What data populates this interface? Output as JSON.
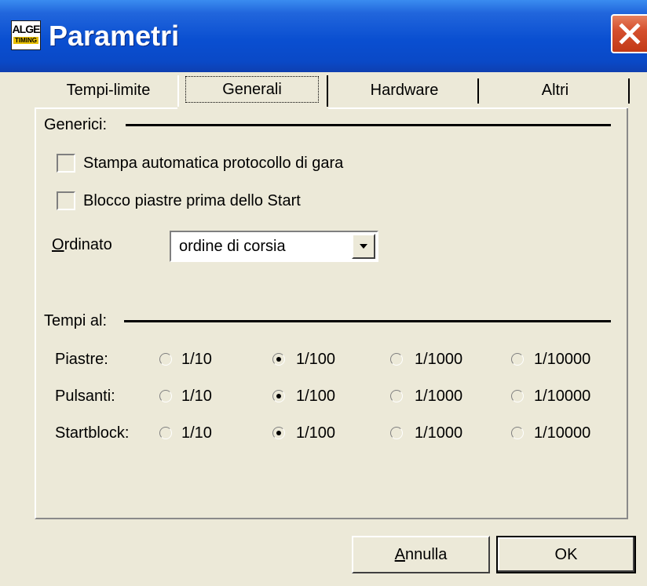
{
  "window": {
    "title": "Parametri",
    "logo_top": "ALGE",
    "logo_bottom": "TIMING"
  },
  "tabs": [
    {
      "label": "Tempi-limite",
      "selected": false
    },
    {
      "label": "Generali",
      "selected": true
    },
    {
      "label": "Hardware",
      "selected": false
    },
    {
      "label": "Altri",
      "selected": false
    }
  ],
  "generici": {
    "label": "Generici:",
    "stampa": {
      "label": "Stampa automatica protocollo di gara",
      "checked": false
    },
    "blocco": {
      "label": "Blocco piastre prima dello Start",
      "checked": false
    },
    "ordinato": {
      "label_first": "O",
      "label_rest": "rdinato",
      "value": "ordine di corsia"
    }
  },
  "tempi": {
    "label": "Tempi al:",
    "options": [
      "1/10",
      "1/100",
      "1/1000",
      "1/10000"
    ],
    "rows": [
      {
        "label": "Piastre:",
        "selected": "1/100"
      },
      {
        "label": "Pulsanti:",
        "selected": "1/100"
      },
      {
        "label": "Startblock:",
        "selected": "1/100"
      }
    ]
  },
  "buttons": {
    "cancel_first": "A",
    "cancel_rest": "nnulla",
    "ok": "OK"
  },
  "colors": {
    "titlebar": "#0a4fd1",
    "dialog_bg": "#ece9d8",
    "close": "#d5502e"
  }
}
